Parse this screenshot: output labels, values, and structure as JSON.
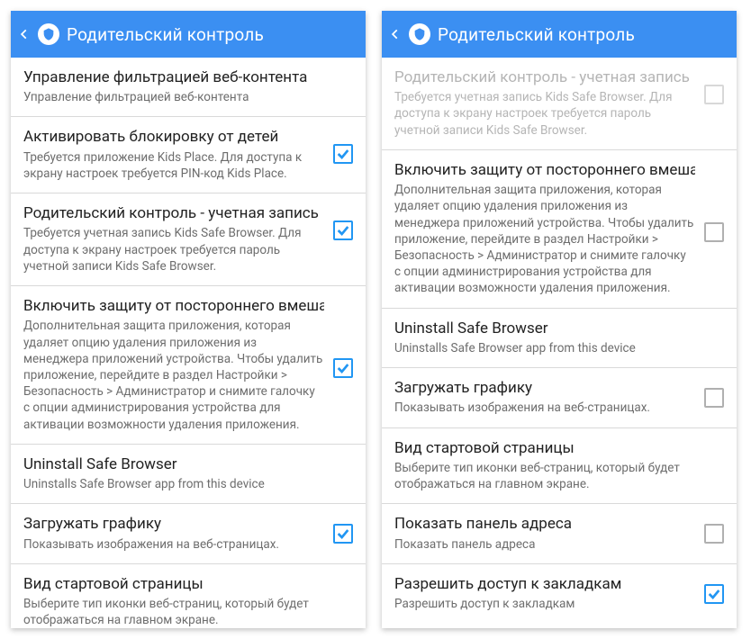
{
  "topbar": {
    "title": "Родительский контроль"
  },
  "left": {
    "items": [
      {
        "title": "Управление фильтрацией веб-контента",
        "sub": "Управление фильтрацией веб-контента"
      },
      {
        "title": "Активировать блокировку от детей",
        "sub": "Требуется приложение Kids Place. Для доступа к экрану настроек требуется PIN-код Kids Place."
      },
      {
        "title": "Родительский контроль - учетная запись",
        "sub": "Требуется учетная запись Kids Safe Browser. Для доступа к экрану настроек требуется пароль учетной записи Kids Safe Browser."
      },
      {
        "title": "Включить защиту от постороннего вмешательства",
        "sub": "Дополнительная защита приложения, которая удаляет опцию удаления приложения из менеджера приложений устройства. Чтобы удалить приложение, перейдите в раздел Настройки > Безопасность > Администратор и снимите галочку с опции администрирования устройства для активации возможности удаления приложения."
      },
      {
        "title": "Uninstall Safe Browser",
        "sub": "Uninstalls Safe Browser app from this device"
      },
      {
        "title": "Загружать графику",
        "sub": "Показывать изображения на веб-страницах."
      },
      {
        "title": "Вид стартовой страницы",
        "sub": "Выберите тип иконки веб-страниц, который будет отображаться на главном экране."
      }
    ]
  },
  "right": {
    "items": [
      {
        "title": "Родительский контроль - учетная запись",
        "sub": "Требуется учетная запись Kids Safe Browser. Для доступа к экрану настроек требуется пароль учетной записи Kids Safe Browser."
      },
      {
        "title": "Включить защиту от постороннего вмешательства",
        "sub": "Дополнительная защита приложения, которая удаляет опцию удаления приложения из менеджера приложений устройства. Чтобы удалить приложение, перейдите в раздел Настройки > Безопасность > Администратор и снимите галочку с опции администрирования устройства для активации возможности удаления приложения."
      },
      {
        "title": "Uninstall Safe Browser",
        "sub": "Uninstalls Safe Browser app from this device"
      },
      {
        "title": "Загружать графику",
        "sub": "Показывать изображения на веб-страницах."
      },
      {
        "title": "Вид стартовой страницы",
        "sub": "Выберите тип иконки веб-страниц, который будет отображаться на главном экране."
      },
      {
        "title": "Показать панель адреса",
        "sub": "Показать панель адреса"
      },
      {
        "title": "Разрешить доступ к закладкам",
        "sub": "Разрешить доступ к закладкам"
      }
    ]
  }
}
